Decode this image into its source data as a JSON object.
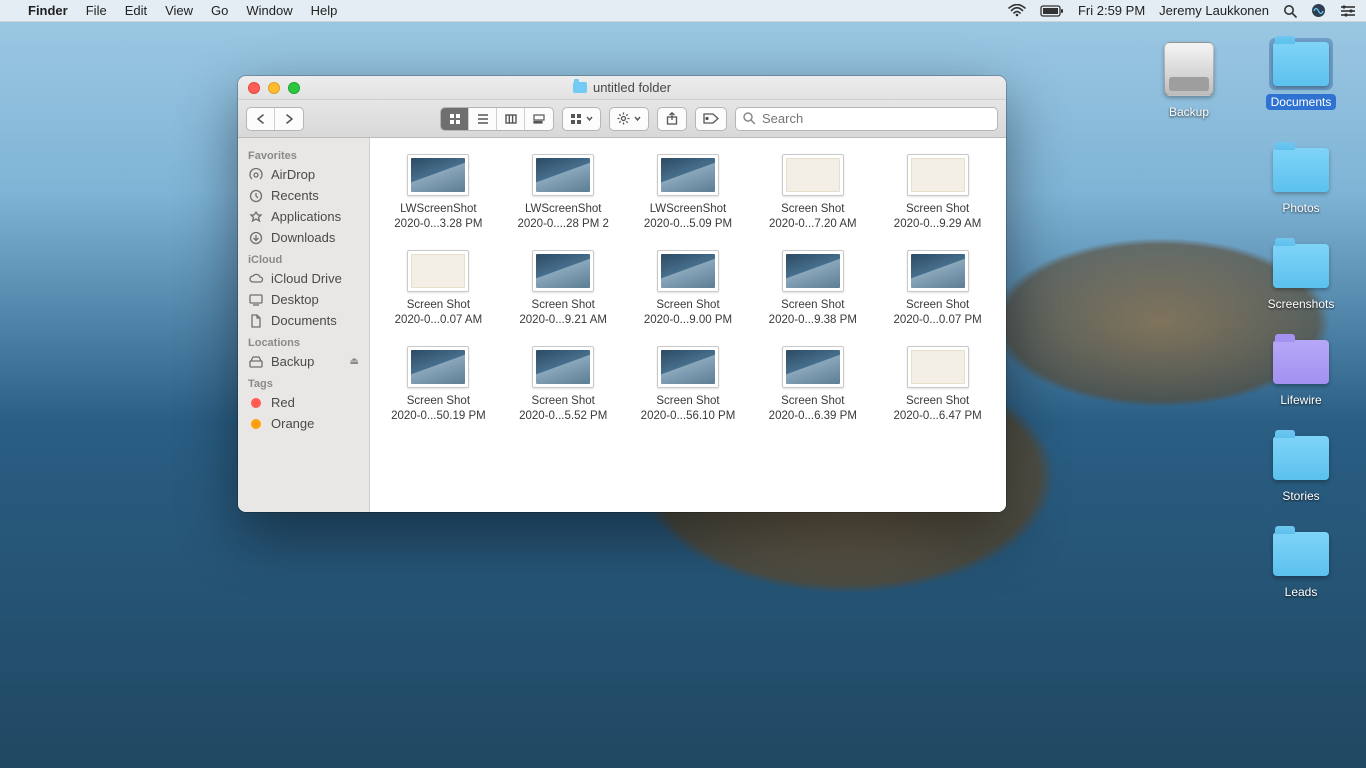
{
  "menubar": {
    "app": "Finder",
    "items": [
      "File",
      "Edit",
      "View",
      "Go",
      "Window",
      "Help"
    ],
    "clock": "Fri 2:59 PM",
    "user": "Jeremy Laukkonen"
  },
  "desktop": {
    "backup": "Backup",
    "documents": "Documents",
    "photos": "Photos",
    "screenshots": "Screenshots",
    "lifewire": "Lifewire",
    "stories": "Stories",
    "leads": "Leads"
  },
  "finder": {
    "title": "untitled folder",
    "search_placeholder": "Search",
    "sidebar": {
      "favorites_header": "Favorites",
      "favorites": [
        "AirDrop",
        "Recents",
        "Applications",
        "Downloads"
      ],
      "icloud_header": "iCloud",
      "icloud": [
        "iCloud Drive",
        "Desktop",
        "Documents"
      ],
      "locations_header": "Locations",
      "locations": [
        "Backup"
      ],
      "tags_header": "Tags",
      "tags": [
        {
          "label": "Red",
          "color": "#ff5b50"
        },
        {
          "label": "Orange",
          "color": "#ff9f0a"
        }
      ]
    },
    "files": [
      {
        "line1": "LWScreenShot",
        "line2": "2020-0...3.28 PM",
        "variant": "dark"
      },
      {
        "line1": "LWScreenShot",
        "line2": "2020-0....28 PM 2",
        "variant": "dark"
      },
      {
        "line1": "LWScreenShot",
        "line2": "2020-0...5.09 PM",
        "variant": "dark"
      },
      {
        "line1": "Screen Shot",
        "line2": "2020-0...7.20 AM",
        "variant": "light"
      },
      {
        "line1": "Screen Shot",
        "line2": "2020-0...9.29 AM",
        "variant": "light"
      },
      {
        "line1": "Screen Shot",
        "line2": "2020-0...0.07 AM",
        "variant": "light"
      },
      {
        "line1": "Screen Shot",
        "line2": "2020-0...9.21 AM",
        "variant": "dark"
      },
      {
        "line1": "Screen Shot",
        "line2": "2020-0...9.00 PM",
        "variant": "dark"
      },
      {
        "line1": "Screen Shot",
        "line2": "2020-0...9.38 PM",
        "variant": "dark"
      },
      {
        "line1": "Screen Shot",
        "line2": "2020-0...0.07 PM",
        "variant": "dark"
      },
      {
        "line1": "Screen Shot",
        "line2": "2020-0...50.19 PM",
        "variant": "dark"
      },
      {
        "line1": "Screen Shot",
        "line2": "2020-0...5.52 PM",
        "variant": "dark"
      },
      {
        "line1": "Screen Shot",
        "line2": "2020-0...56.10 PM",
        "variant": "dark"
      },
      {
        "line1": "Screen Shot",
        "line2": "2020-0...6.39 PM",
        "variant": "dark"
      },
      {
        "line1": "Screen Shot",
        "line2": "2020-0...6.47 PM",
        "variant": "light"
      }
    ]
  }
}
